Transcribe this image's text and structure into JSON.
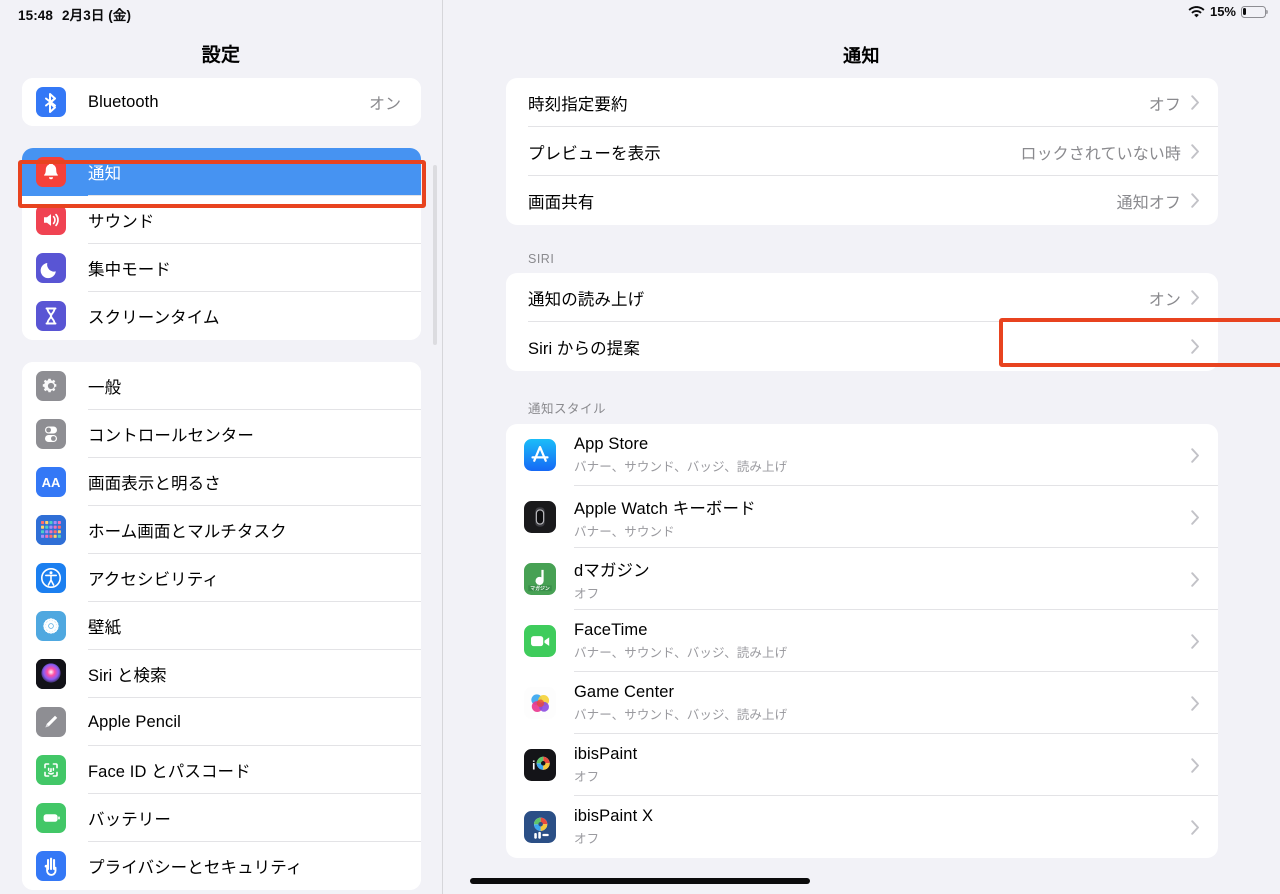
{
  "statusbar": {
    "time": "15:48",
    "date": "2月3日 (金)",
    "wifi_icon": "wifi-icon",
    "battery_percent": "15%",
    "battery_level": 15,
    "battery_icon": "battery-icon"
  },
  "sidebar": {
    "title": "設定",
    "groups": [
      {
        "items": [
          {
            "label": "Bluetooth",
            "value": "オン",
            "icon": "bluetooth-icon",
            "icon_color": "#3478f6",
            "selected": false
          }
        ]
      },
      {
        "items": [
          {
            "label": "通知",
            "value": "",
            "icon": "bell-icon",
            "icon_color": "#f5413a",
            "selected": true
          },
          {
            "label": "サウンド",
            "value": "",
            "icon": "speaker-icon",
            "icon_color": "#f04352",
            "selected": false
          },
          {
            "label": "集中モード",
            "value": "",
            "icon": "moon-icon",
            "icon_color": "#5955d4",
            "selected": false
          },
          {
            "label": "スクリーンタイム",
            "value": "",
            "icon": "hourglass-icon",
            "icon_color": "#5955d4",
            "selected": false
          }
        ]
      },
      {
        "items": [
          {
            "label": "一般",
            "value": "",
            "icon": "gear-icon",
            "icon_color": "#8e8e93",
            "selected": false
          },
          {
            "label": "コントロールセンター",
            "value": "",
            "icon": "toggles-icon",
            "icon_color": "#8e8e93",
            "selected": false
          },
          {
            "label": "画面表示と明るさ",
            "value": "",
            "icon": "text-size-icon",
            "icon_color": "#3478f6",
            "selected": false
          },
          {
            "label": "ホーム画面とマルチタスク",
            "value": "",
            "icon": "home-screen-icon",
            "icon_color": "#3478f6",
            "selected": false
          },
          {
            "label": "アクセシビリティ",
            "value": "",
            "icon": "accessibility-icon",
            "icon_color": "#1b7ff0",
            "selected": false
          },
          {
            "label": "壁紙",
            "value": "",
            "icon": "wallpaper-icon",
            "icon_color": "#4fa8e0",
            "selected": false
          },
          {
            "label": "Siri と検索",
            "value": "",
            "icon": "siri-icon",
            "icon_color": "#1c1c22",
            "selected": false
          },
          {
            "label": "Apple Pencil",
            "value": "",
            "icon": "pencil-icon",
            "icon_color": "#8e8e93",
            "selected": false
          },
          {
            "label": "Face ID とパスコード",
            "value": "",
            "icon": "faceid-icon",
            "icon_color": "#42c767",
            "selected": false
          },
          {
            "label": "バッテリー",
            "value": "",
            "icon": "battery-settings-icon",
            "icon_color": "#42c767",
            "selected": false
          },
          {
            "label": "プライバシーとセキュリティ",
            "value": "",
            "icon": "privacy-hand-icon",
            "icon_color": "#3478f6",
            "selected": false
          }
        ]
      }
    ],
    "highlight": {
      "target": "通知",
      "color": "#e8431f"
    }
  },
  "detail": {
    "title": "通知",
    "top_group": {
      "rows": [
        {
          "label": "時刻指定要約",
          "value": "オフ"
        },
        {
          "label": "プレビューを表示",
          "value": "ロックされていない時"
        },
        {
          "label": "画面共有",
          "value": "通知オフ"
        }
      ]
    },
    "siri_section": {
      "header": "SIRI",
      "rows": [
        {
          "label": "通知の読み上げ",
          "value": "オン",
          "highlighted": true
        },
        {
          "label": "Siri からの提案",
          "value": "",
          "highlighted": false
        }
      ]
    },
    "notification_style_section": {
      "header": "通知スタイル",
      "apps": [
        {
          "name": "App Store",
          "detail": "バナー、サウンド、バッジ、読み上げ",
          "icon": "app-store-icon"
        },
        {
          "name": "Apple Watch キーボード",
          "detail": "バナー、サウンド",
          "icon": "apple-watch-icon"
        },
        {
          "name": "dマガジン",
          "detail": "オフ",
          "icon": "d-magazine-icon"
        },
        {
          "name": "FaceTime",
          "detail": "バナー、サウンド、バッジ、読み上げ",
          "icon": "facetime-icon"
        },
        {
          "name": "Game Center",
          "detail": "バナー、サウンド、バッジ、読み上げ",
          "icon": "game-center-icon"
        },
        {
          "name": "ibisPaint",
          "detail": "オフ",
          "icon": "ibispaint-icon"
        },
        {
          "name": "ibisPaint X",
          "detail": "オフ",
          "icon": "ibispaint-x-icon"
        }
      ]
    },
    "highlight": {
      "target": "通知の読み上げ",
      "color": "#e8431f"
    }
  },
  "colors": {
    "accent_blue": "#4693f2",
    "annotation_red": "#e8431f",
    "background": "#f2f2f7",
    "card": "#ffffff",
    "secondary_text": "#8a8a8e"
  }
}
